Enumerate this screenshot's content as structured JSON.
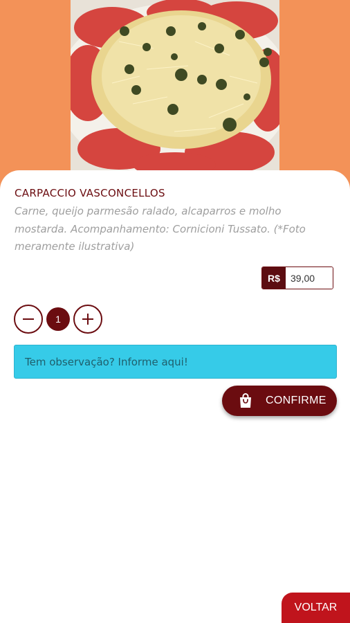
{
  "product": {
    "name": "CARPACCIO VASCONCELLOS",
    "description": "Carne, queijo parmesão ralado, alcaparros e molho mostarda. Acompanhamento: Cornicioni Tussato. (*Foto meramente ilustrativa)",
    "currency": "R$",
    "price": "39,00",
    "image_icon": "food-photo"
  },
  "quantity": {
    "value": "1",
    "decrement_icon": "minus-icon",
    "increment_icon": "plus-icon"
  },
  "observation": {
    "placeholder": "Tem observação? Informe aqui!"
  },
  "actions": {
    "confirm_label": "CONFIRME",
    "confirm_icon": "shopping-bag-icon",
    "back_label": "VOLTAR"
  },
  "colors": {
    "header_bg": "#f39258",
    "brand": "#6b0c10",
    "observation_bg": "#36cbe8",
    "back_button": "#c0141c"
  }
}
